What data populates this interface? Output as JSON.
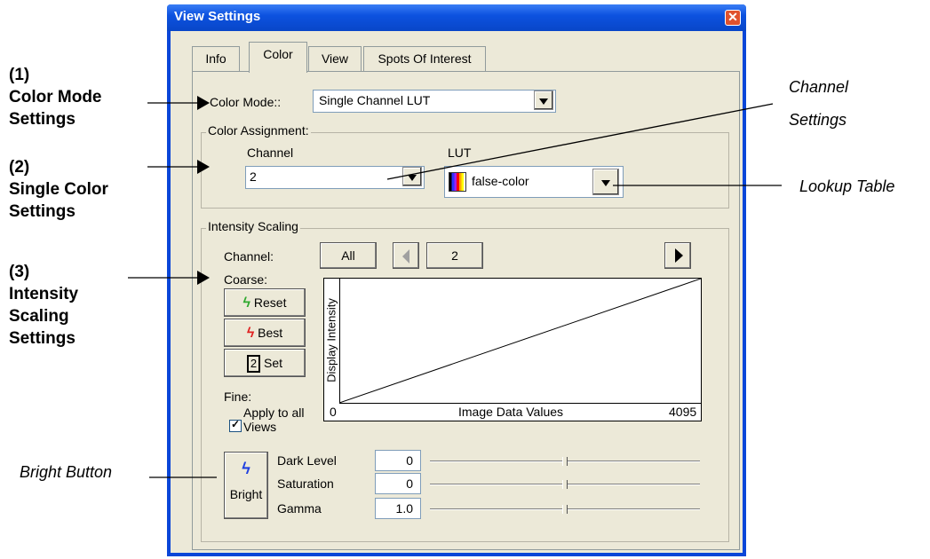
{
  "window": {
    "title": "View Settings",
    "close_glyph": "✕"
  },
  "tabs": [
    {
      "label": "Info"
    },
    {
      "label": "Color"
    },
    {
      "label": "View"
    },
    {
      "label": "Spots Of Interest"
    }
  ],
  "color_mode": {
    "label": "Color Mode::",
    "value": "Single Channel LUT"
  },
  "color_assignment": {
    "legend": "Color Assignment:",
    "channel_label": "Channel",
    "channel_value": "2",
    "lut_label": "LUT",
    "lut_value": "false-color"
  },
  "intensity": {
    "legend": "Intensity Scaling",
    "channel_label": "Channel:",
    "all_button": "All",
    "channel_value": "2",
    "coarse_label": "Coarse:",
    "reset_label": "Reset",
    "best_label": "Best",
    "set_icon_text": "2",
    "set_label": "Set",
    "fine_label": "Fine:",
    "apply_line1": "Apply to all",
    "apply_line2": "Views",
    "apply_checked": true,
    "plot": {
      "ylabel": "Display Intensity",
      "xlabel": "Image Data Values",
      "xmin": "0",
      "xmax": "4095"
    },
    "bright_label": "Bright",
    "sliders": [
      {
        "label": "Dark Level",
        "value": "0",
        "level": 0.5
      },
      {
        "label": "Saturation",
        "value": "0",
        "level": 0.5
      },
      {
        "label": "Gamma",
        "value": "1.0",
        "level": 0.5
      }
    ]
  },
  "annotations": {
    "a1_num": "(1)",
    "a1_l1": "Color Mode",
    "a1_l2": "Settings",
    "a2_num": "(2)",
    "a2_l1": "Single Color",
    "a2_l2": "Settings",
    "a3_num": "(3)",
    "a3_l1": "Intensity",
    "a3_l2": "Scaling",
    "a3_l3": "Settings",
    "channel_l1": "Channel",
    "channel_l2": "Settings",
    "lookup": "Lookup Table",
    "bright": "Bright Button"
  },
  "colors": {
    "title_bar": "#0a46d8",
    "window_bg": "#ece9d8",
    "reset_icon": "#2ea82e",
    "best_icon": "#e02020",
    "bright_icon": "#2040e0"
  }
}
